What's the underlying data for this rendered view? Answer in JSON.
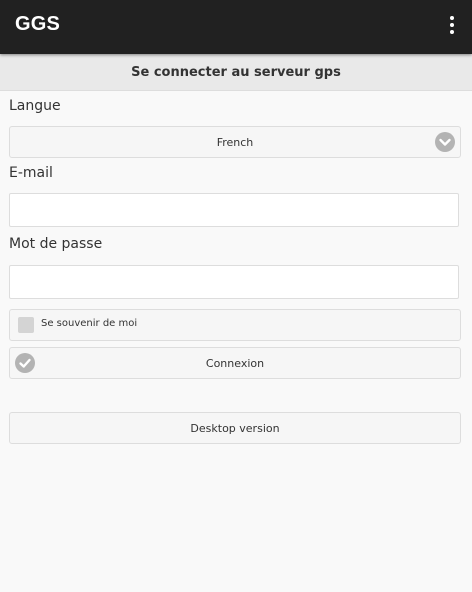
{
  "appbar": {
    "title": "GGS",
    "menu_icon": "more-vert-icon"
  },
  "header": {
    "title": "Se connecter au serveur gps"
  },
  "form": {
    "language": {
      "label": "Langue",
      "selected": "French",
      "icon": "chevron-down-icon"
    },
    "email": {
      "label": "E-mail",
      "value": ""
    },
    "password": {
      "label": "Mot de passe",
      "value": ""
    },
    "remember": {
      "label": "Se souvenir de moi",
      "checked": false
    },
    "login": {
      "label": "Connexion",
      "icon": "check-icon"
    },
    "desktop": {
      "label": "Desktop version"
    }
  },
  "colors": {
    "appbar": "#212121",
    "header": "#e9e9e9",
    "background": "#f9f9f9",
    "icon_circle": "#b3b3b3"
  }
}
